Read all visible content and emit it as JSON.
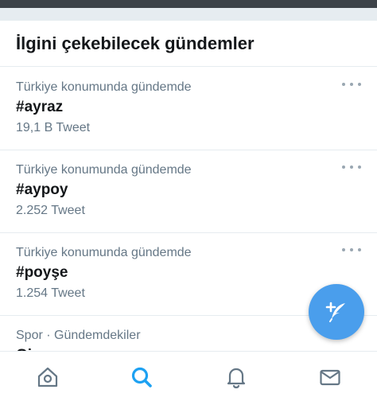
{
  "header": {
    "title": "İlgini çekebilecek gündemler"
  },
  "trends": [
    {
      "context": "Türkiye konumunda gündemde",
      "name": "#ayraz",
      "count": "19,1 B Tweet"
    },
    {
      "context": "Türkiye konumunda gündemde",
      "name": "#aypoy",
      "count": "2.252 Tweet"
    },
    {
      "context": "Türkiye konumunda gündemde",
      "name": "#poyşe",
      "count": "1.254 Tweet"
    },
    {
      "context": "Spor · Gündemdekiler",
      "name": "Gireşun"
    }
  ],
  "icons": {
    "more": "more-horizontal-icon",
    "compose": "compose-tweet-icon",
    "home": "home-icon",
    "search": "search-icon",
    "notifications": "bell-icon",
    "messages": "mail-icon"
  },
  "colors": {
    "accent": "#1da1f2",
    "fab": "#4a9eec",
    "secondary_text": "#657786",
    "tab_inactive": "#657786"
  }
}
